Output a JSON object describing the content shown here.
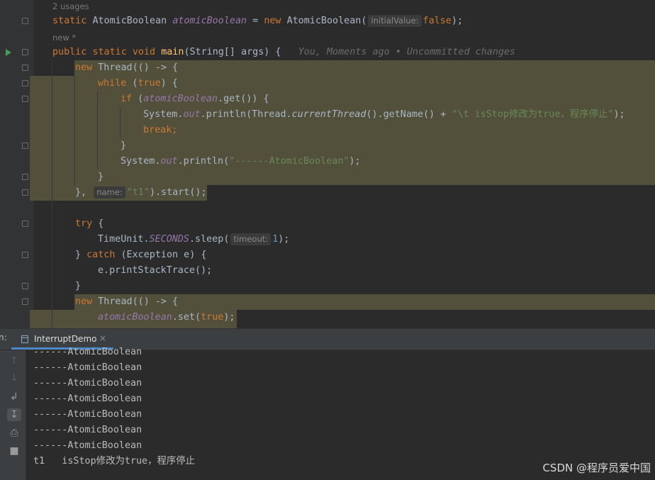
{
  "editor": {
    "usages_hint": "2 usages",
    "new_hint": "new *",
    "field_decl": {
      "kw": "static",
      "type": "AtomicBoolean",
      "name": "atomicBoolean",
      "eq": " = ",
      "new_kw": "new",
      "ctor": "AtomicBoolean(",
      "param_hint": "initialValue:",
      "value": "false",
      "end": ");"
    },
    "main_decl": {
      "kw": "public static void",
      "name": "main",
      "params": "(String[] args) {",
      "blame": "You, Moments ago • Uncommitted changes"
    },
    "lines": {
      "l3_new": "new",
      "l3_rest": " Thread(() -> {",
      "l4_while": "while",
      "l4_rest": " (",
      "l4_true": "true",
      "l4_end": ") {",
      "l5_if": "if",
      "l5_open": " (",
      "l5_field": "atomicBoolean",
      "l5_rest": ".get()) {",
      "l6_sys": "System.",
      "l6_out": "out",
      "l6_mid": ".println(Thread.",
      "l6_ct": "currentThread",
      "l6_rest": "().getName() + ",
      "l6_str": "\"\\t isStop修改为true，程序停止\"",
      "l6_end": ");",
      "l7_break": "break;",
      "l8": "}",
      "l9_sys": "System.",
      "l9_out": "out",
      "l9_mid": ".println(",
      "l9_str": "\"------AtomicBoolean\"",
      "l9_end": ");",
      "l10": "}",
      "l11_close": "},",
      "l11_hint": "name:",
      "l11_str": "\"t1\"",
      "l11_end": ").start();",
      "l13_try": "try",
      "l13_end": " {",
      "l14_a": "TimeUnit.",
      "l14_b": "SECONDS",
      "l14_c": ".sleep(",
      "l14_hint": "timeout:",
      "l14_num": "1",
      "l14_end": ");",
      "l15_a": "} ",
      "l15_catch": "catch",
      "l15_rest": " (Exception e) {",
      "l16": "e.printStackTrace();",
      "l17": "}",
      "l18_new": "new",
      "l18_rest": " Thread(() -> {",
      "l19_field": "atomicBoolean",
      "l19_mid": ".set(",
      "l19_true": "true",
      "l19_end": ");"
    }
  },
  "run_panel": {
    "run_label": "n:",
    "tab_label": "InterruptDemo",
    "close_glyph": "×",
    "tools": [
      "up-arrow-icon",
      "down-arrow-icon",
      "soft-wrap-icon",
      "scroll-to-end-icon",
      "print-icon",
      "trash-icon"
    ],
    "output": [
      "------AtomicBoolean",
      "------AtomicBoolean",
      "------AtomicBoolean",
      "------AtomicBoolean",
      "------AtomicBoolean",
      "------AtomicBoolean",
      "------AtomicBoolean",
      "t1   isStop修改为true，程序停止"
    ]
  },
  "watermark": "CSDN @程序员爱中国",
  "colors": {
    "background": "#2b2b2b",
    "keyword": "#cc7832",
    "field": "#9876aa",
    "string": "#6a8759",
    "method": "#ffc66d",
    "number": "#6897bb",
    "highlight": "#52503a",
    "accent": "#4a88c7"
  }
}
